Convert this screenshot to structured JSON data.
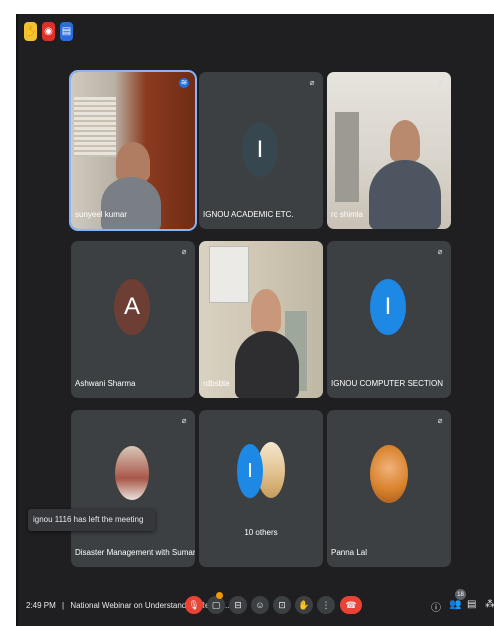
{
  "top_icons": [
    "hand-raise-icon",
    "record-icon",
    "present-icon"
  ],
  "tiles": [
    {
      "name": "sunyeel kumar"
    },
    {
      "name": "IGNOU ACADEMIC ETC.",
      "initial": "I",
      "avatar_color": "#37474f"
    },
    {
      "name": "rc shimla"
    },
    {
      "name": "Ashwani Sharma",
      "initial": "A",
      "avatar_color": "#6d3f34"
    },
    {
      "name": "rdbsbte"
    },
    {
      "name": "IGNOU COMPUTER SECTION",
      "initial": "I",
      "avatar_color": "#1e88e5"
    },
    {
      "name": "Disaster Management with Suman"
    },
    {
      "name": "10 others",
      "initial": "I",
      "avatar_color": "#1e88e5"
    },
    {
      "name": "Panna Lal"
    }
  ],
  "notification": "ignou 1116 has left the meeting",
  "bottom": {
    "time": "2:49 PM",
    "separator": "|",
    "meeting_title": "National Webinar on Understanding Record...",
    "participant_count": "18"
  },
  "colors": {
    "accent": "#8ab4f8",
    "end_call": "#ea4335",
    "tile_bg": "#3c4043"
  }
}
